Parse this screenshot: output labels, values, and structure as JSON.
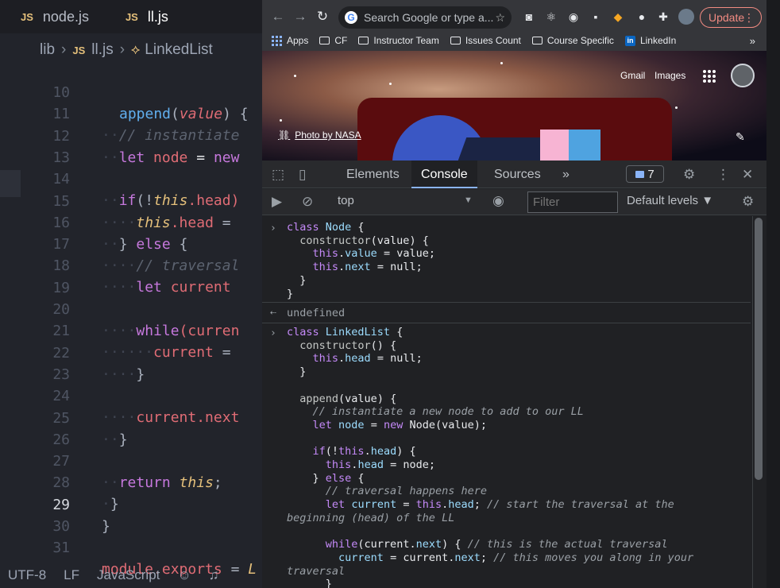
{
  "editor": {
    "tabs": [
      {
        "icon": "JS",
        "label": "node.js"
      },
      {
        "icon": "JS",
        "label": "ll.js"
      }
    ],
    "breadcrumb": {
      "folder": "lib",
      "file_icon": "JS",
      "file": "ll.js",
      "symbol_icon": "class-icon",
      "symbol": "LinkedList"
    },
    "lines": [
      {
        "num": "10",
        "current": false
      },
      {
        "num": "11",
        "current": false
      },
      {
        "num": "12",
        "current": false
      },
      {
        "num": "13",
        "current": false
      },
      {
        "num": "14",
        "current": false
      },
      {
        "num": "15",
        "current": false
      },
      {
        "num": "16",
        "current": false
      },
      {
        "num": "17",
        "current": false
      },
      {
        "num": "18",
        "current": false
      },
      {
        "num": "19",
        "current": false
      },
      {
        "num": "20",
        "current": false
      },
      {
        "num": "21",
        "current": false
      },
      {
        "num": "22",
        "current": false
      },
      {
        "num": "23",
        "current": false
      },
      {
        "num": "24",
        "current": false
      },
      {
        "num": "25",
        "current": false
      },
      {
        "num": "26",
        "current": false
      },
      {
        "num": "27",
        "current": false
      },
      {
        "num": "28",
        "current": false
      },
      {
        "num": "29",
        "current": true
      },
      {
        "num": "30",
        "current": false
      },
      {
        "num": "31",
        "current": false
      }
    ],
    "code": {
      "l10a": "append",
      "l10b": "(",
      "l10c": "value",
      "l10d": ") {",
      "l11": "// instantiate",
      "l12a": "let",
      "l12b": "node",
      "l12c": "=",
      "l12d": "new",
      "l14a": "if",
      "l14b": "(!",
      "l14c": "this",
      "l14d": ".head)",
      "l15a": "this",
      "l15b": ".head",
      "l15c": "=",
      "l16a": "} ",
      "l16b": "else",
      "l16c": " {",
      "l17": "// traversal",
      "l18a": "let",
      "l18b": "current",
      "l20a": "while",
      "l20b": "(curren",
      "l21a": "current",
      "l21b": "=",
      "l22": "}",
      "l24": "current.next",
      "l25": "}",
      "l27a": "return",
      "l27b": "this",
      "l27c": ";",
      "l28": "}",
      "l29": "}",
      "l31a": "module",
      "l31b": ".exports",
      "l31c": "=",
      "l31d": "L"
    },
    "status": {
      "encoding": "UTF-8",
      "eol": "LF",
      "language": "JavaScript"
    }
  },
  "browser": {
    "omnibox_placeholder": "Search Google or type a...",
    "update_label": "Update",
    "bookmarks": [
      {
        "icon": "apps-icon",
        "label": "Apps"
      },
      {
        "icon": "folder-icon",
        "label": "CF"
      },
      {
        "icon": "folder-icon",
        "label": "Instructor Team"
      },
      {
        "icon": "folder-icon",
        "label": "Issues Count"
      },
      {
        "icon": "folder-icon",
        "label": "Course Specific"
      },
      {
        "icon": "linkedin-icon",
        "label": "LinkedIn"
      }
    ],
    "bookmarks_more": "»",
    "page": {
      "gmail": "Gmail",
      "images": "Images",
      "photo_credit": "Photo by NASA"
    }
  },
  "devtools": {
    "tabs": [
      "Elements",
      "Console",
      "Sources"
    ],
    "more_tabs": "»",
    "active_tab": "Console",
    "message_count": "7",
    "context": "top",
    "filter_placeholder": "Filter",
    "levels": "Default levels ▼"
  },
  "console": {
    "undefined_text": "undefined",
    "block1": [
      "class Node {",
      "  constructor(value) {",
      "    this.value = value;",
      "    this.next = null;",
      "  }",
      "}"
    ],
    "block2": [
      "class LinkedList {",
      "  constructor() {",
      "    this.head = null;",
      "  }",
      "",
      "  append(value) {",
      "    // instantiate a new node to add to our LL",
      "    let node = new Node(value);",
      "",
      "    if(!this.head) {",
      "      this.head = node;",
      "    } else {",
      "      // traversal happens here",
      "      let current = this.head; // start the traversal at the",
      "beginning (head) of the LL",
      "",
      "      while(current.next) { // this is the actual traversal",
      "        current = current.next; // this moves you along in your",
      "traversal",
      "      }"
    ]
  }
}
